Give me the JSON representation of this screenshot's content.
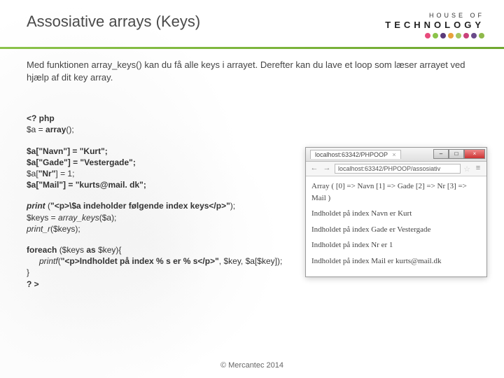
{
  "header": {
    "title": "Assosiative arrays (Keys)",
    "logo_top": "HOUSE OF",
    "logo_bottom": "TECHNOLOGY"
  },
  "intro": "Med funktionen array_keys() kan du få alle keys i arrayet. Derefter kan du lave et loop som læser arrayet ved hjælp af dit key array.",
  "code": {
    "open": "<? php",
    "decl": "$a = array();",
    "assign": [
      "$a[\"Navn\"] = \"Kurt\";",
      "$a[\"Gade\"] = \"Vestergade\";",
      "$a[\"Nr\"] = 1;",
      "$a[\"Mail\"] = \"kurts@mail. dk\";"
    ],
    "print_line": "print (\"<p>\\$a indeholder følgende index keys</p>\");",
    "keys_line": "$keys = array_keys($a);",
    "printr_line": "print_r($keys);",
    "foreach_open": "foreach ($keys as $key){",
    "foreach_body": "printf(\"<p>Indholdet på index % s er % s</p>\", $key, $a[$key]);",
    "brace": "}",
    "close": "? >"
  },
  "browser": {
    "tab_label": "localhost:63342/PHPOOP",
    "url": "localhost:63342/PHPOOP/assosiativ",
    "lines": [
      "Array ( [0] => Navn [1] => Gade [2] => Nr [3] => Mail )",
      "Indholdet på index Navn er Kurt",
      "Indholdet på index Gade er Vestergade",
      "Indholdet på index Nr er 1",
      "Indholdet på index Mail er kurts@mail.dk"
    ],
    "minimize": "–",
    "maximize": "□",
    "close": "×",
    "back": "←",
    "forward": "→",
    "star": "☆",
    "menu": "≡"
  },
  "footer": "© Mercantec 2014"
}
